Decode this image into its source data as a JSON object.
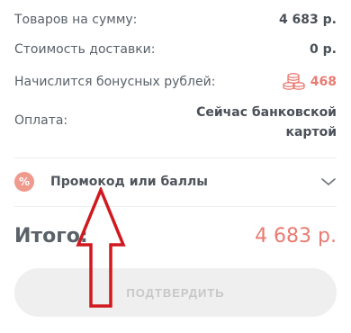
{
  "summary": {
    "goods_label": "Товаров на сумму:",
    "goods_value": "4 683 р.",
    "delivery_label": "Стоимость доставки:",
    "delivery_value": "0 р.",
    "bonus_label": "Начислится бонусных рублей:",
    "bonus_value": "468",
    "bonus_icon": "coins-icon",
    "payment_label": "Оплата:",
    "payment_value_line1": "Сейчас банковской",
    "payment_value_line2": "картой"
  },
  "promo": {
    "icon": "percent-icon",
    "label": "Промокод или баллы",
    "chevron": "chevron-down-icon"
  },
  "total": {
    "label": "Итого:",
    "value": "4 683 р."
  },
  "confirm_button": {
    "label": "ПОДТВЕРДИТЬ"
  },
  "colors": {
    "accent": "#e97b72",
    "annotation_arrow": "#d0191f",
    "button_disabled_bg": "#efefef"
  }
}
